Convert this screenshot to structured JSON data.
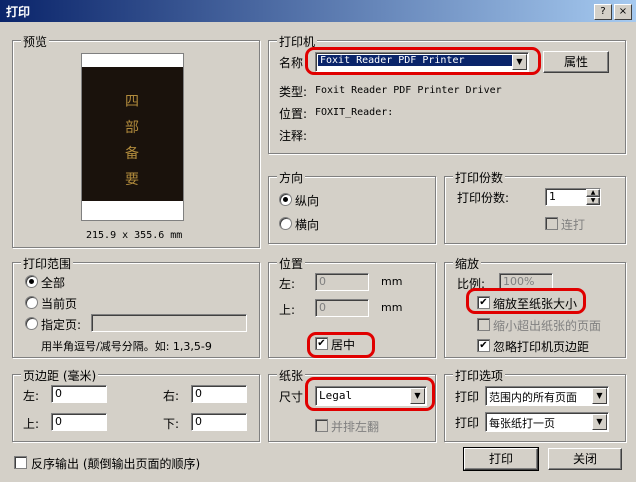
{
  "window": {
    "title": "打印",
    "help": "?",
    "close": "×"
  },
  "preview": {
    "group": "预览",
    "size": "215.9 x 355.6 mm",
    "glyphs": [
      "四",
      "部",
      "备",
      "要"
    ]
  },
  "printer": {
    "group": "打印机",
    "name_label": "名称",
    "name_value": "Foxit Reader PDF Printer",
    "properties": "属性",
    "type_label": "类型:",
    "type_value": "Foxit Reader PDF Printer Driver",
    "location_label": "位置:",
    "location_value": "FOXIT_Reader:",
    "comment_label": "注释:"
  },
  "orientation": {
    "group": "方向",
    "portrait": "纵向",
    "landscape": "横向"
  },
  "copies": {
    "group": "打印份数",
    "label": "打印份数:",
    "value": "1",
    "collate": "连打"
  },
  "range": {
    "group": "打印范围",
    "all": "全部",
    "current": "当前页",
    "pages": "指定页:",
    "hint": "用半角逗号/减号分隔。如: 1,3,5-9"
  },
  "position": {
    "group": "位置",
    "left": "左:",
    "left_value": "0",
    "left_unit": "mm",
    "top": "上:",
    "top_value": "0",
    "top_unit": "mm",
    "center": "居中"
  },
  "scaling": {
    "group": "缩放",
    "ratio_label": "比例:",
    "ratio_value": "100%",
    "fit": "缩放至纸张大小",
    "shrink": "缩小超出纸张的页面",
    "ignore_margins": "忽略打印机页边距"
  },
  "margins": {
    "group": "页边距 (毫米)",
    "left": "左:",
    "left_value": "0",
    "right": "右:",
    "right_value": "0",
    "top": "上:",
    "top_value": "0",
    "bottom": "下:",
    "bottom_value": "0"
  },
  "paper": {
    "group": "纸张",
    "size_label": "尺寸",
    "size_value": "Legal",
    "duplex": "并排左翻"
  },
  "options": {
    "group": "打印选项",
    "label1": "打印",
    "value1": "范围内的所有页面",
    "label2": "打印",
    "value2": "每张纸打一页"
  },
  "footer": {
    "reverse": "反序输出 (颠倒输出页面的顺序)",
    "print": "打印",
    "close": "关闭"
  },
  "colors": {
    "highlight": "#e00000",
    "title_bar": "#0a246a",
    "selection": "#0a246a"
  }
}
